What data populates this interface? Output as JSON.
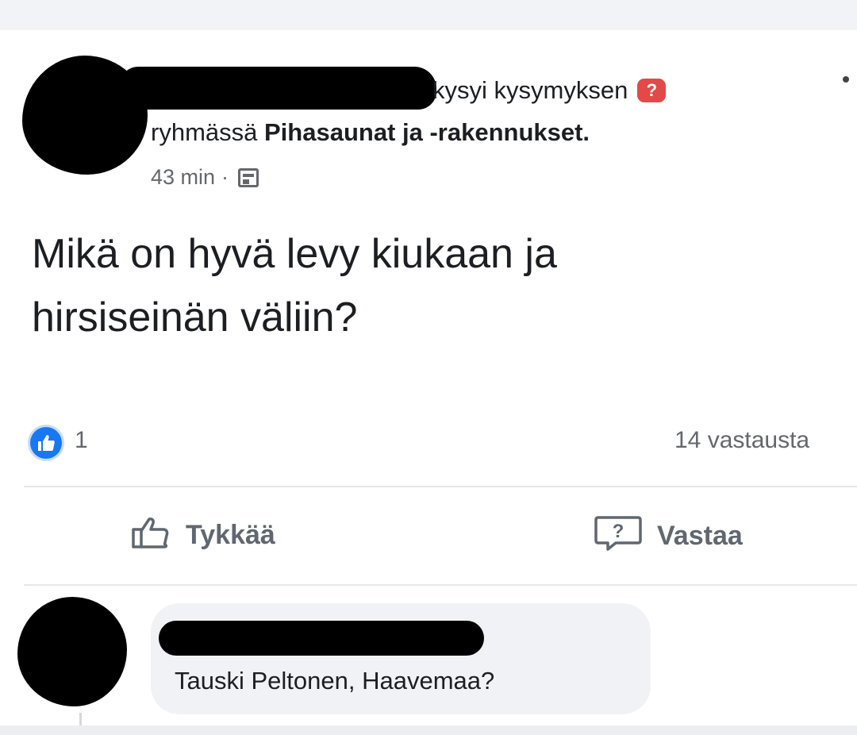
{
  "post": {
    "action_text": "kysyi kysymyksen",
    "question_badge": "?",
    "group_prefix": "ryhmässä",
    "group_name": "Pihasaunat ja -rakennukset.",
    "time": "43 min",
    "meta_separator": "·",
    "body_line1": "Mikä on hyvä levy kiukaan ja",
    "body_line2": "hirsiseinän väliin?"
  },
  "stats": {
    "like_count": "1",
    "answers": "14 vastausta"
  },
  "actions": {
    "like_label": "Tykkää",
    "answer_label": "Vastaa"
  },
  "comment": {
    "text": "Tauski Peltonen, Haavemaa?"
  },
  "icons": {
    "question": "question-badge-icon",
    "group": "group-icon",
    "like": "thumbs-up-icon",
    "answer": "question-bubble-icon",
    "more": "more-options-icon"
  },
  "colors": {
    "brand_blue": "#1877f2",
    "question_red": "#e24a4a",
    "secondary_text": "#65676b"
  }
}
